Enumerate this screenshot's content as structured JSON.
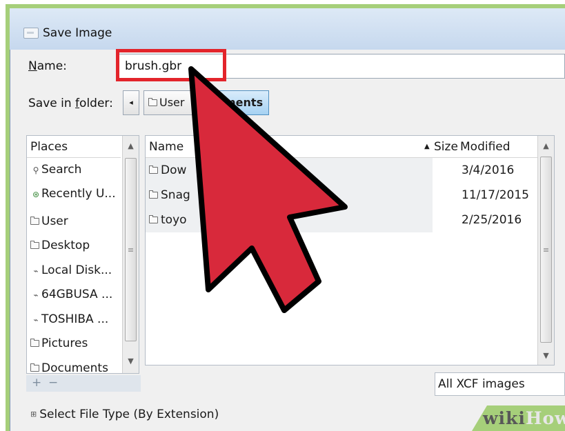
{
  "window": {
    "title": "Save Image"
  },
  "name_field": {
    "label": "Name:",
    "value": "brush.gbr"
  },
  "save_in": {
    "label": "Save in folder:",
    "path": [
      "User",
      "Documents"
    ],
    "path_visible": [
      "User",
      "ments"
    ]
  },
  "places": {
    "header": "Places",
    "items": [
      {
        "label": "Search",
        "icon": "search-icon"
      },
      {
        "label": "Recently U...",
        "icon": "recent-icon"
      },
      {
        "label": "User",
        "icon": "folder-icon"
      },
      {
        "label": "Desktop",
        "icon": "folder-icon"
      },
      {
        "label": "Local Disk...",
        "icon": "drive-icon"
      },
      {
        "label": "64GBUSA ...",
        "icon": "drive-icon"
      },
      {
        "label": "TOSHIBA ...",
        "icon": "drive-icon"
      },
      {
        "label": "Pictures",
        "icon": "folder-icon"
      },
      {
        "label": "Documents",
        "icon": "folder-icon"
      }
    ],
    "add": "+",
    "remove": "−"
  },
  "files": {
    "columns": {
      "name": "Name",
      "size": "Size",
      "modified": "Modified"
    },
    "rows": [
      {
        "name": "Dow",
        "modified": "3/4/2016"
      },
      {
        "name": "Snag",
        "modified": "11/17/2015"
      },
      {
        "name": "toyo",
        "modified": "2/25/2016"
      }
    ]
  },
  "filter": {
    "value": "All XCF images"
  },
  "file_type": {
    "label": "Select File Type (By Extension)"
  },
  "watermark": {
    "part1": "wiki",
    "part2": "How"
  },
  "colors": {
    "highlight": "#e3242b",
    "pointer_fill": "#d8293b",
    "frame": "#a6cf7a",
    "active_path": "#a6d2f2"
  }
}
